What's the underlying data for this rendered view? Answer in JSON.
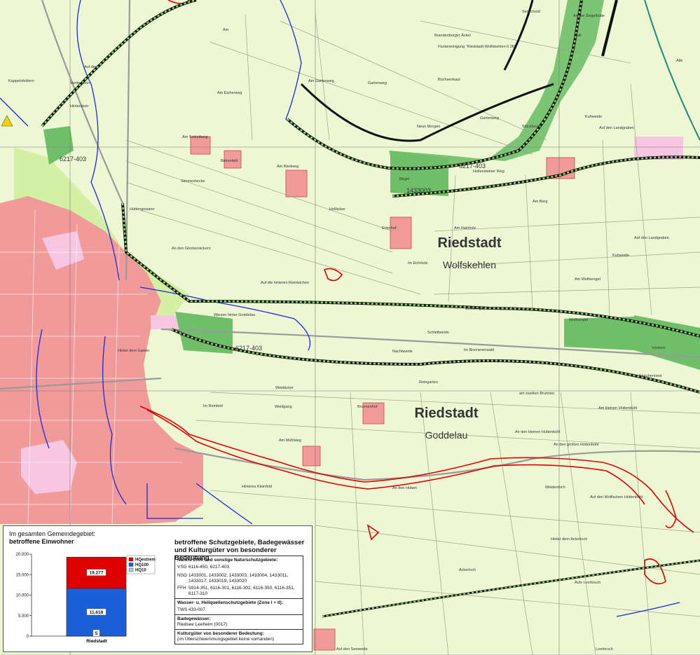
{
  "towns": [
    {
      "name": "Riedstadt",
      "district": "Wolfskehlen"
    },
    {
      "name": "Riedstadt",
      "district": "Goddelau"
    }
  ],
  "zone_labels": [
    "6217-403",
    "6217-403",
    "6217-403",
    "1433003"
  ],
  "field_names": [
    "Senscheid",
    "An der Ziegelhütte",
    "Am",
    "Brandenburger Äcker",
    "Flurbereinigung \"Riedstadt-Wolfskehlen 6 28\"",
    "Rall",
    "Alte",
    "Auf die",
    "Kappelsfeldern",
    "Vorderstein",
    "Am Gartenweg",
    "Gartenweg",
    "Büchsenkaut",
    "Hinterstein",
    "Am Eicherweg",
    "Neun Morgen",
    "Gartenweg",
    "Stückbruch",
    "Kuhweide",
    "Auf den Landgraben",
    "Am Schleifweg",
    "Birkenfeld",
    "Am Riedweg",
    "Simmeshecke",
    "Birgel",
    "Hollensteiner Weg",
    "Am Berg",
    "Hüttengewann",
    "Holläcker",
    "Erlenhof",
    "Am Hainholz",
    "An den Glockenäckern",
    "Im Eichholz",
    "Auf den Landgraben",
    "Kuhweide",
    "Auf die hinteren Reinteichen",
    "Am Wolfsengel",
    "Wolfsengel",
    "Wiesen hinter Goddelau",
    "Schleifweide",
    "Wolfsengel",
    "Nachtweide",
    "Im Bremenerwald",
    "Vordere",
    "Hinter dem Garten",
    "Storchennest",
    "Weidäcker",
    "Reingarten",
    "am zweiten Brunnen",
    "Im Reinfeld",
    "Brunnenhof",
    "Weidgang",
    "Am kleinen Hüttenbühl",
    "Am Mühlweg",
    "An den kleinen Hüttenbühl",
    "An den großen Hüttenbühl",
    "Hinteres Kleinfeld",
    "An den Hüben",
    "Weidenloch",
    "Auf den Wolfischen Hüttenbühl",
    "Hinter dem Ackerloch",
    "Ackerloch",
    "Aufs Leerbruch",
    "Leerbruch",
    "Auf den Seeweide"
  ],
  "legend": {
    "header_line1": "Im gesamten Gemeindegebiet:",
    "header_line2": "betroffene Einwohner",
    "protection_title_line1": "betroffene Schutzgebiete, Badegewässer",
    "protection_title_line2": "und Kulturgüter von besonderer Bedeutung",
    "natura_title": "Natura 2000 und sonstige Naturschutzgebiete:",
    "vsg_key": "VSG",
    "vsg_value": "6116-450, 6217-403",
    "nsg_key": "NSG",
    "nsg_value": "1433001, 1433002, 1433003, 1433004, 1433011, 1433017, 1433019, 1433020",
    "ffh_key": "FFH",
    "ffh_value": "5914-351, 6116-301, 6116-302, 6116-350, 6116-351, 6117-310",
    "water_title": "Wasser- u. Heilquellenschutzgebiete (Zone I + II):",
    "tws_key": "TWS",
    "tws_value": "433-007",
    "bathing_title": "Badegewässer:",
    "bathing_value": "Riedsee Leeheim (0017)",
    "cultural_title": "Kulturgüter von besonderer Bedeutung:",
    "cultural_value": "(im Überschwemmungsgebiet keine vorhanden)"
  },
  "chart_data": {
    "type": "bar",
    "categories": [
      "Riedstadt"
    ],
    "series": [
      {
        "name": "HQextrem",
        "values": [
          19277
        ],
        "label": "19.277",
        "color": "#e00000"
      },
      {
        "name": "HQ100",
        "values": [
          11618
        ],
        "label": "11.618",
        "color": "#1a5fd6"
      },
      {
        "name": "HQ10",
        "values": [
          5
        ],
        "label": "5",
        "color": "#9fd0ff"
      }
    ],
    "ylim": [
      0,
      20000
    ],
    "yticks": [
      "0",
      "5.000",
      "10.000",
      "15.000",
      "20.000"
    ],
    "ytick_values": [
      0,
      5000,
      10000,
      15000,
      20000
    ],
    "legend_position": "top-right",
    "grid": false
  },
  "colors": {
    "map_background": "#eef7d4",
    "settlement": "#f08a8a",
    "protection_zone": "#7fc97a",
    "hazard_area": "#ccf0a0",
    "river": "#1a2ad9",
    "flood_extent": "#e00000",
    "boundary": "#111111"
  }
}
